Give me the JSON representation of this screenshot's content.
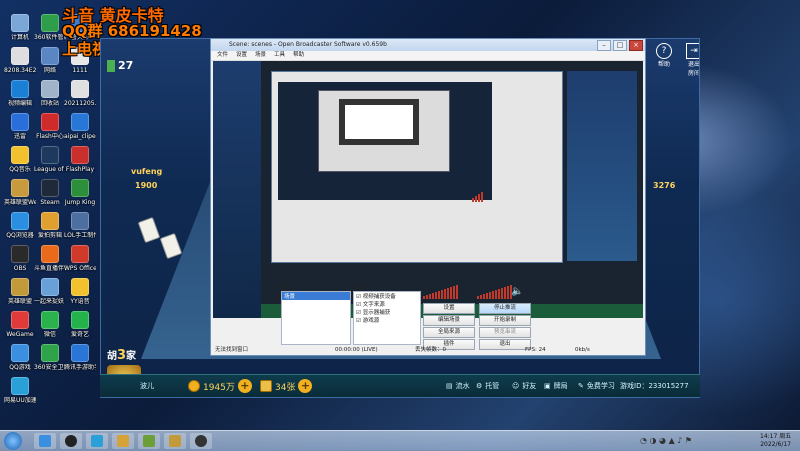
{
  "overlay": {
    "line1": "斗音 黄皮卡特",
    "line2": "QQ群 686191428",
    "line3": "上电视 q 805297990"
  },
  "desktop_icons": [
    {
      "label": "计算机",
      "color": "#7aa7d8"
    },
    {
      "label": "360软件管家",
      "color": "#2e9e4a"
    },
    {
      "label": "鲁大师",
      "color": "#3d7bd0"
    },
    {
      "label": "8208.34E2...副本",
      "color": "#dedede"
    },
    {
      "label": "网络",
      "color": "#5b86c4"
    },
    {
      "label": "1111",
      "color": "#e8e8e8"
    },
    {
      "label": "视频编辑",
      "color": "#1b7fd6"
    },
    {
      "label": "回收站",
      "color": "#9fb4c8"
    },
    {
      "label": "20211205...",
      "color": "#e0e0e0"
    },
    {
      "label": "迅雷",
      "color": "#2a6fd9"
    },
    {
      "label": "Flash中心",
      "color": "#d02b2b"
    },
    {
      "label": "aipai_cliper",
      "color": "#2876d6"
    },
    {
      "label": "QQ音乐",
      "color": "#f2c12e"
    },
    {
      "label": "League of Legends",
      "color": "#1d3a5e"
    },
    {
      "label": "FlashPlay",
      "color": "#c9302c"
    },
    {
      "label": "英雄联盟WeGame版",
      "color": "#c69a3d"
    },
    {
      "label": "Steam",
      "color": "#1e2a3a"
    },
    {
      "label": "Jump King",
      "color": "#2d8f3a"
    },
    {
      "label": "QQ浏览器",
      "color": "#2a8fe0"
    },
    {
      "label": "爱拍剪辑",
      "color": "#e0a030"
    },
    {
      "label": "LOL手工制作卡特跳舞",
      "color": "#4d6fa0"
    },
    {
      "label": "OBS",
      "color": "#2a2a2a"
    },
    {
      "label": "斗鱼直播伴侣",
      "color": "#e86a1a"
    },
    {
      "label": "WPS Office",
      "color": "#d03a2a"
    },
    {
      "label": "英雄联盟",
      "color": "#c39a3a"
    },
    {
      "label": "一起来捉妖 - 一手内测",
      "color": "#6aa0d8"
    },
    {
      "label": "YY语音",
      "color": "#f2c12e"
    },
    {
      "label": "WeGame",
      "color": "#e03a3a"
    },
    {
      "label": "微信",
      "color": "#2bb24c"
    },
    {
      "label": "爱奇艺",
      "color": "#24b34a"
    },
    {
      "label": "QQ游戏",
      "color": "#3a8fe0"
    },
    {
      "label": "360安全卫士",
      "color": "#2fa34a"
    },
    {
      "label": "腾讯手游助手",
      "color": "#2a76d6"
    },
    {
      "label": "网易UU加速器",
      "color": "#2a9fd8"
    }
  ],
  "game": {
    "coins_top": "27",
    "left_coins": "1900",
    "right_coins": "3276",
    "player_name": "vufeng",
    "round": "3",
    "bottom_name": "波儿",
    "gold": "1945万",
    "tickets": "34张",
    "bottom_buttons": [
      "流水",
      "托管",
      "好友",
      "牌局",
      "免费学习"
    ],
    "game_id": "游戏ID：233015277",
    "top_right": [
      "帮助",
      "退出房间"
    ]
  },
  "obs": {
    "title": "Scene: scenes - Open Broadcaster Software v0.659b",
    "menus": [
      "文件",
      "设置",
      "场景",
      "工具",
      "帮助"
    ],
    "scenes_label": "场景：",
    "sources_label": "来源：",
    "scene_item": "场景",
    "sources": [
      "视频捕获设备",
      "文字来源",
      "显示器捕获",
      "游戏源"
    ],
    "buttons": {
      "settings": "设置",
      "stop_stream": "停止推流",
      "edit_scene": "编辑场景",
      "start_record": "开始录制",
      "global_sources": "全局来源",
      "stop_preview": "预览串流",
      "plugins": "插件",
      "exit": "退出"
    },
    "status": {
      "message": "无法找到窗口",
      "time": "00:00:00 (LIVE)",
      "dropped": "丢失帧数：0",
      "fps": "FPS: 24",
      "bitrate": "0kb/s"
    }
  },
  "taskbar": {
    "clock": "14:17 周五",
    "date": "2022/6/17"
  }
}
